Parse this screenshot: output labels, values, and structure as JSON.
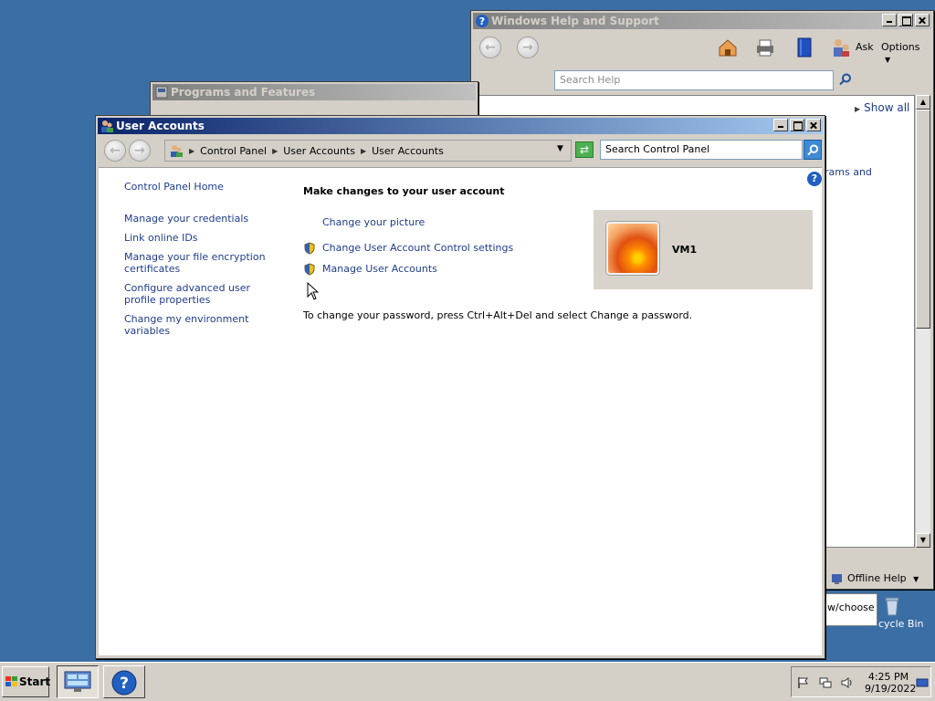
{
  "help_window": {
    "title": "Windows Help and Support",
    "ask_label": "Ask",
    "options_label": "Options",
    "search_placeholder": "Search Help",
    "show_all": "Show all",
    "partial_text": "rams and",
    "offline_help": "Offline Help"
  },
  "programs_window": {
    "title": "Programs and Features"
  },
  "user_accounts": {
    "title": "User Accounts",
    "breadcrumb": [
      "Control Panel",
      "User Accounts",
      "User Accounts"
    ],
    "search_placeholder": "Search Control Panel",
    "left_links": [
      "Control Panel Home",
      "Manage your credentials",
      "Link online IDs",
      "Manage your file encryption certificates",
      "Configure advanced user profile properties",
      "Change my environment variables"
    ],
    "main_title": "Make changes to your user account",
    "actions": [
      "Change your picture",
      "Change User Account Control settings",
      "Manage User Accounts"
    ],
    "password_info": "To change your password, press Ctrl+Alt+Del and select Change a password.",
    "username": "VM1"
  },
  "desktop": {
    "choose_text": "w/choose",
    "recycle_bin_label": "cycle Bin"
  },
  "taskbar": {
    "start_label": "Start",
    "time": "4:25 PM",
    "date": "9/19/2022"
  }
}
